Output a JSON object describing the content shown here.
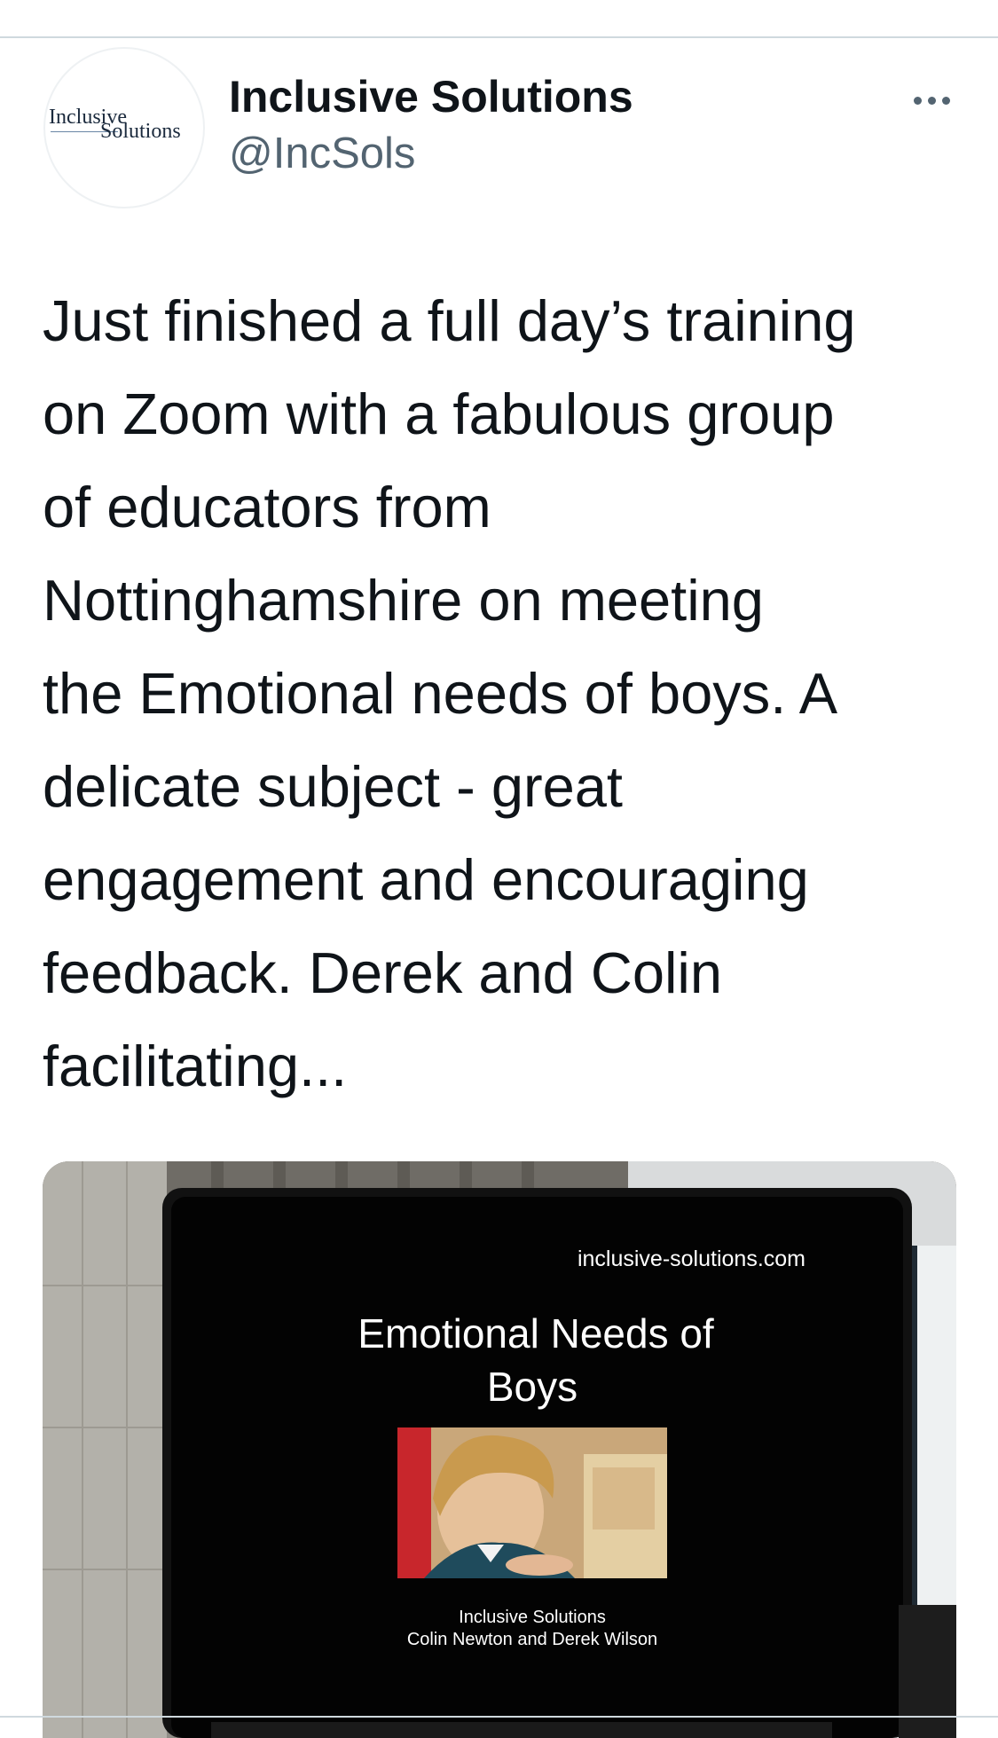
{
  "tweet": {
    "author": {
      "display_name": "Inclusive Solutions",
      "handle": "@IncSols",
      "avatar_logo_top": "Inclusive",
      "avatar_logo_bottom": "Solutions"
    },
    "more_icon": "more-horizontal-icon",
    "text": "Just finished a full day’s training\non Zoom with a fabulous group\nof educators from\nNottinghamshire on meeting\nthe Emotional needs of boys. A\ndelicate subject - great\nengagement and encouraging\nfeedback. Derek and Colin\nfacilitating...",
    "media": {
      "slide_url": "inclusive-solutions.com",
      "slide_title_line1": "Emotional Needs of",
      "slide_title_line2": "Boys",
      "slide_credit_line1": "Inclusive Solutions",
      "slide_credit_line2": "Colin Newton and Derek Wilson"
    }
  }
}
